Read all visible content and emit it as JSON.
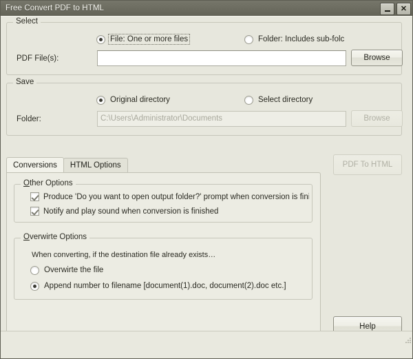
{
  "window": {
    "title": "Free Convert PDF to HTML",
    "minimize_label": "–",
    "close_label": "✕"
  },
  "select_group": {
    "legend": "Select",
    "radio_file": "File:  One or more files",
    "radio_folder": "Folder: Includes sub-folc",
    "pdf_files_label": "PDF File(s):",
    "pdf_files_value": "",
    "browse_label": "Browse"
  },
  "save_group": {
    "legend": "Save",
    "radio_original": "Original directory",
    "radio_select": "Select directory",
    "folder_label": "Folder:",
    "folder_value": "C:\\Users\\Administrator\\Documents",
    "browse_label": "Browse"
  },
  "tabs": [
    {
      "label": "Conversions",
      "active": true
    },
    {
      "label": "HTML Options",
      "active": false
    }
  ],
  "other_options": {
    "legend": "Other Options",
    "checkbox_prompt": "Produce 'Do you want to open output folder?' prompt when conversion is finished",
    "checkbox_notify": "Notify and play sound when conversion is finished"
  },
  "overwrite_options": {
    "legend": "Overwirte Options",
    "description": "When converting, if the destination file already exists…",
    "radio_overwrite": "Overwirte the file",
    "radio_append": "Append number to filename  [document(1).doc, document(2).doc etc.]"
  },
  "actions": {
    "convert_label": "PDF To HTML",
    "help_label": "Help"
  },
  "colors": {
    "window_background": "#e7e7dd",
    "titlebar": "#6d6d61",
    "panel": "#ececE3",
    "text": "#2a2a22",
    "disabled_text": "#a9a99d",
    "border": "#c6c6ba"
  }
}
